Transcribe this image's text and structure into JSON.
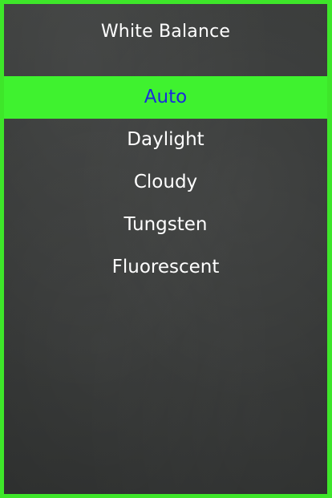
{
  "panel": {
    "title": "White Balance"
  },
  "menu": {
    "selected_index": 0,
    "items": [
      {
        "label": "Auto"
      },
      {
        "label": "Daylight"
      },
      {
        "label": "Cloudy"
      },
      {
        "label": "Tungsten"
      },
      {
        "label": "Fluorescent"
      }
    ]
  },
  "colors": {
    "frame_border": "#3ee62a",
    "selection_background": "#3ff22f",
    "selection_text": "#1a2adc",
    "text": "#ffffff",
    "background": "#363837"
  }
}
